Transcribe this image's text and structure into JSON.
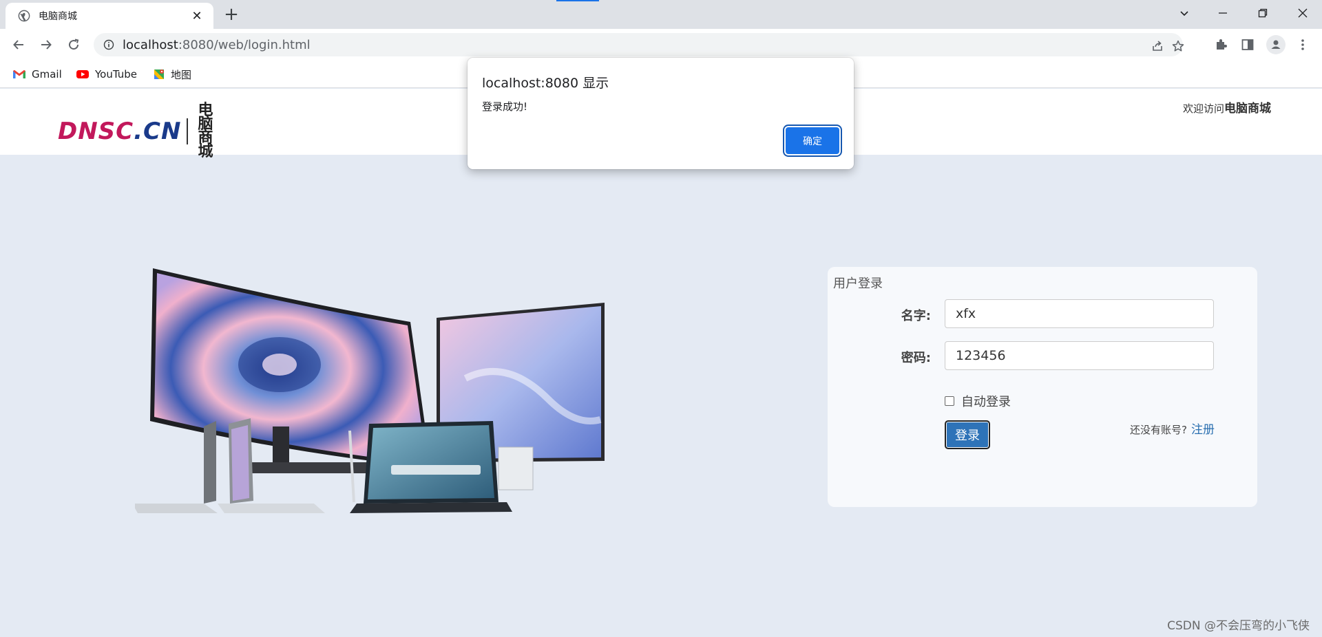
{
  "browser": {
    "tab_title": "电脑商城",
    "new_tab": "+",
    "url_host": "localhost",
    "url_rest": ":8080/web/login.html",
    "bookmarks": [
      {
        "label": "Gmail",
        "icon": "gmail-icon"
      },
      {
        "label": "YouTube",
        "icon": "youtube-icon"
      },
      {
        "label": "地图",
        "icon": "maps-icon"
      }
    ]
  },
  "header": {
    "logo_text": "DNSC.CN",
    "logo_cn_1": "电脑",
    "logo_cn_2": "商城",
    "welcome_prefix": "欢迎访问",
    "welcome_site": "电脑商城"
  },
  "login": {
    "title": "用户登录",
    "name_label": "名字:",
    "name_value": "xfx",
    "password_label": "密码:",
    "password_value": "123456",
    "auto_login_label": "自动登录",
    "auto_login_checked": false,
    "submit_label": "登录",
    "no_account_text": "还没有账号?",
    "register_link": "注册"
  },
  "dialog": {
    "title": "localhost:8080 显示",
    "message": "登录成功!",
    "ok_label": "确定"
  },
  "watermark": "CSDN @不会压弯的小飞侠",
  "colors": {
    "page_bg": "#e4eaf3",
    "dialog_button": "#1a73e8",
    "login_button": "#2e73b8",
    "logo_magenta": "#c2185b",
    "logo_blue": "#1a3a8a"
  }
}
